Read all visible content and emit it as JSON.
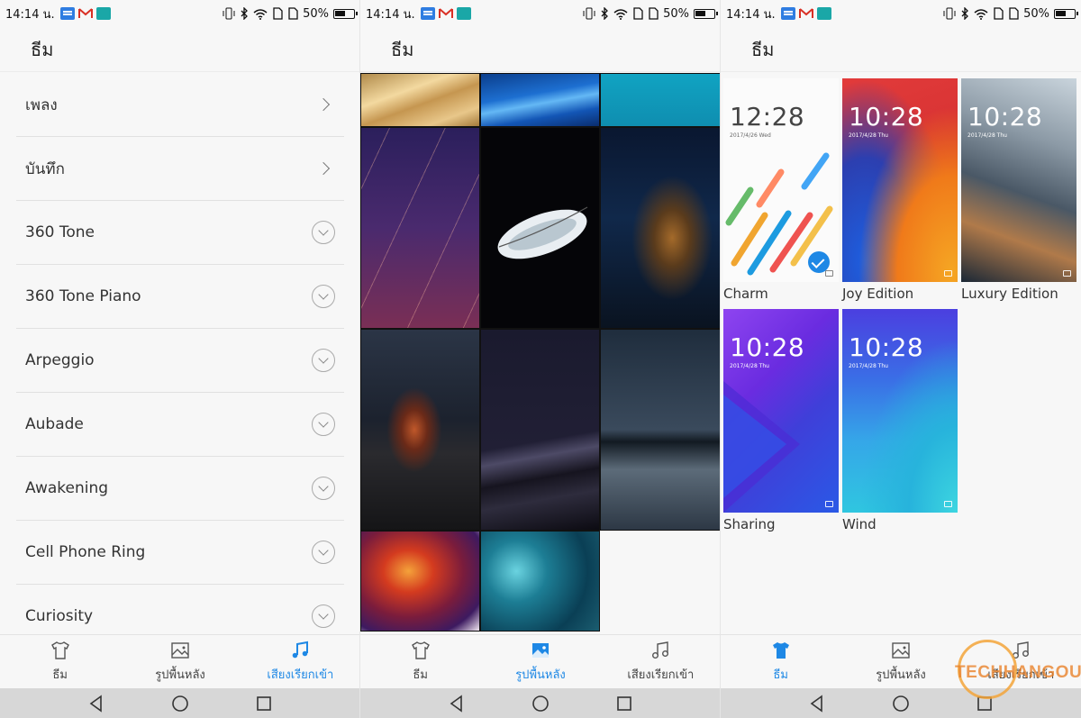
{
  "status_bar": {
    "time": "14:14 น.",
    "battery": "50%"
  },
  "screens": [
    {
      "title": "ธีม",
      "items": [
        {
          "label": "เพลง",
          "indicator": "chevron-right"
        },
        {
          "label": "บันทึก",
          "indicator": "chevron-right"
        },
        {
          "label": "360 Tone",
          "indicator": "expand-circle"
        },
        {
          "label": "360 Tone Piano",
          "indicator": "expand-circle"
        },
        {
          "label": "Arpeggio",
          "indicator": "expand-circle"
        },
        {
          "label": "Aubade",
          "indicator": "expand-circle"
        },
        {
          "label": "Awakening",
          "indicator": "expand-circle"
        },
        {
          "label": "Cell Phone Ring",
          "indicator": "expand-circle"
        },
        {
          "label": "Curiosity",
          "indicator": "expand-circle"
        }
      ],
      "active_tab": 2
    },
    {
      "title": "ธีม",
      "wallpapers": [
        "gold-waves",
        "blue-streaks",
        "teal-gradient",
        "purple-meteors",
        "white-feather",
        "night-cliff-town",
        "night-mountains",
        "night-dunes",
        "night-sea",
        "lava-red",
        "teal-crystal"
      ],
      "active_tab": 1
    },
    {
      "title": "ธีม",
      "themes": [
        {
          "name": "Charm",
          "clock": "12:28",
          "date": "2017/4/26 Wed",
          "selected": true
        },
        {
          "name": "Joy Edition",
          "clock": "10:28",
          "date": "2017/4/28 Thu",
          "selected": false
        },
        {
          "name": "Luxury Edition",
          "clock": "10:28",
          "date": "2017/4/28 Thu",
          "selected": false
        },
        {
          "name": "Sharing",
          "clock": "10:28",
          "date": "2017/4/28 Thu",
          "selected": false
        },
        {
          "name": "Wind",
          "clock": "10:28",
          "date": "2017/4/28 Thu",
          "selected": false
        }
      ],
      "active_tab": 0
    }
  ],
  "tabs": [
    {
      "label": "ธีม",
      "icon": "shirt-icon"
    },
    {
      "label": "รูปพื้นหลัง",
      "icon": "image-icon"
    },
    {
      "label": "เสียงเรียกเข้า",
      "icon": "music-note-icon"
    }
  ],
  "watermark": "TECHHANGOUT",
  "colors": {
    "accent": "#1e88e5",
    "background": "#f7f7f7",
    "navbar": "#d7d7d7"
  }
}
